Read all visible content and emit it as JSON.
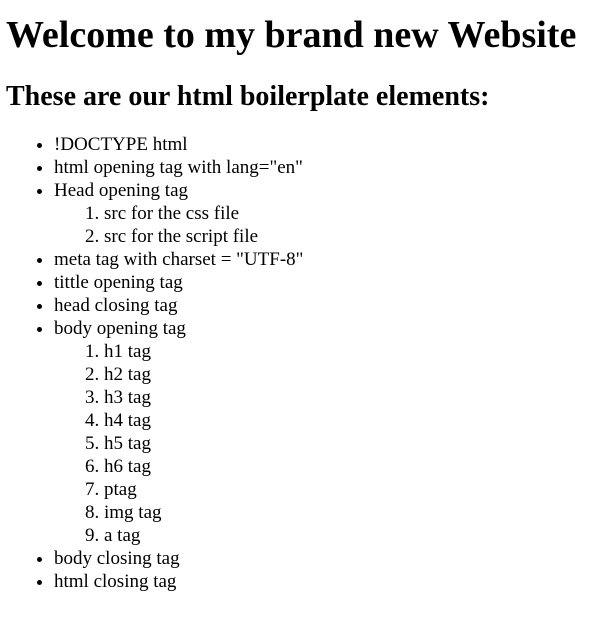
{
  "heading1": "Welcome to my brand new Website",
  "heading2": "These are our html boilerplate elements:",
  "list": {
    "item1": "!DOCTYPE html",
    "item2": "html opening tag with lang=\"en\"",
    "item3": "Head opening tag",
    "head_sub": [
      "src for the css file",
      "src for the script file"
    ],
    "item4": "meta tag with charset = \"UTF-8\"",
    "item5": "tittle opening tag",
    "item6": "head closing tag",
    "item7": "body opening tag",
    "body_sub": [
      "h1 tag",
      "h2 tag",
      "h3 tag",
      "h4 tag",
      "h5 tag",
      "h6 tag",
      "ptag",
      "img tag",
      "a tag"
    ],
    "item8": "body closing tag",
    "item9": "html closing tag"
  }
}
